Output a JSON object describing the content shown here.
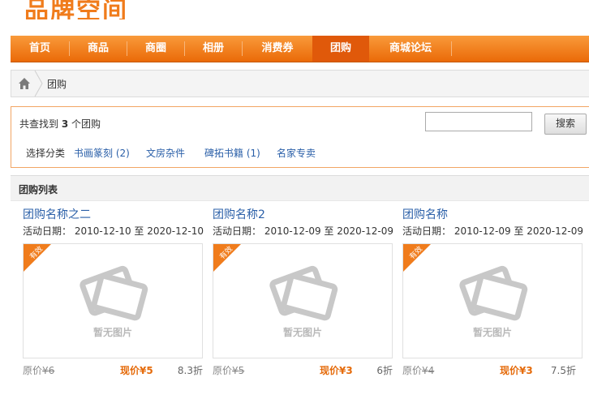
{
  "logo": {
    "text": "品牌空间"
  },
  "nav": {
    "items": [
      {
        "label": "首页"
      },
      {
        "label": "商品"
      },
      {
        "label": "商圈"
      },
      {
        "label": "相册"
      },
      {
        "label": "消费券"
      },
      {
        "label": "团购",
        "active": true
      },
      {
        "label": "商城论坛"
      }
    ]
  },
  "breadcrumb": {
    "current": "团购"
  },
  "filter": {
    "found_prefix": "共查找到",
    "found_count": "3",
    "found_suffix": "个团购",
    "search_value": "",
    "search_button": "搜索",
    "category_label": "选择分类",
    "categories": [
      "书画篆刻 (2)",
      "文房杂件",
      "碑拓书籍 (1)",
      "名家专卖"
    ]
  },
  "list": {
    "title": "团购列表",
    "badge_text": "有效",
    "no_image_text": "暂无图片",
    "date_label": "活动日期：",
    "date_sep": "至",
    "orig_label": "原价",
    "now_label": "现价",
    "currency": "¥",
    "items": [
      {
        "name": "团购名称之二",
        "start": "2010-12-10",
        "end": "2020-12-10",
        "orig_price": "6",
        "now_price": "5",
        "discount": "8.3折"
      },
      {
        "name": "团购名称2",
        "start": "2010-12-09",
        "end": "2020-12-09",
        "orig_price": "5",
        "now_price": "3",
        "discount": "6折"
      },
      {
        "name": "团购名称",
        "start": "2010-12-09",
        "end": "2020-12-09",
        "orig_price": "4",
        "now_price": "3",
        "discount": "7.5折"
      }
    ]
  },
  "colors": {
    "accent": "#f07c1c",
    "link": "#2a5fa8",
    "price": "#e56b0b"
  }
}
